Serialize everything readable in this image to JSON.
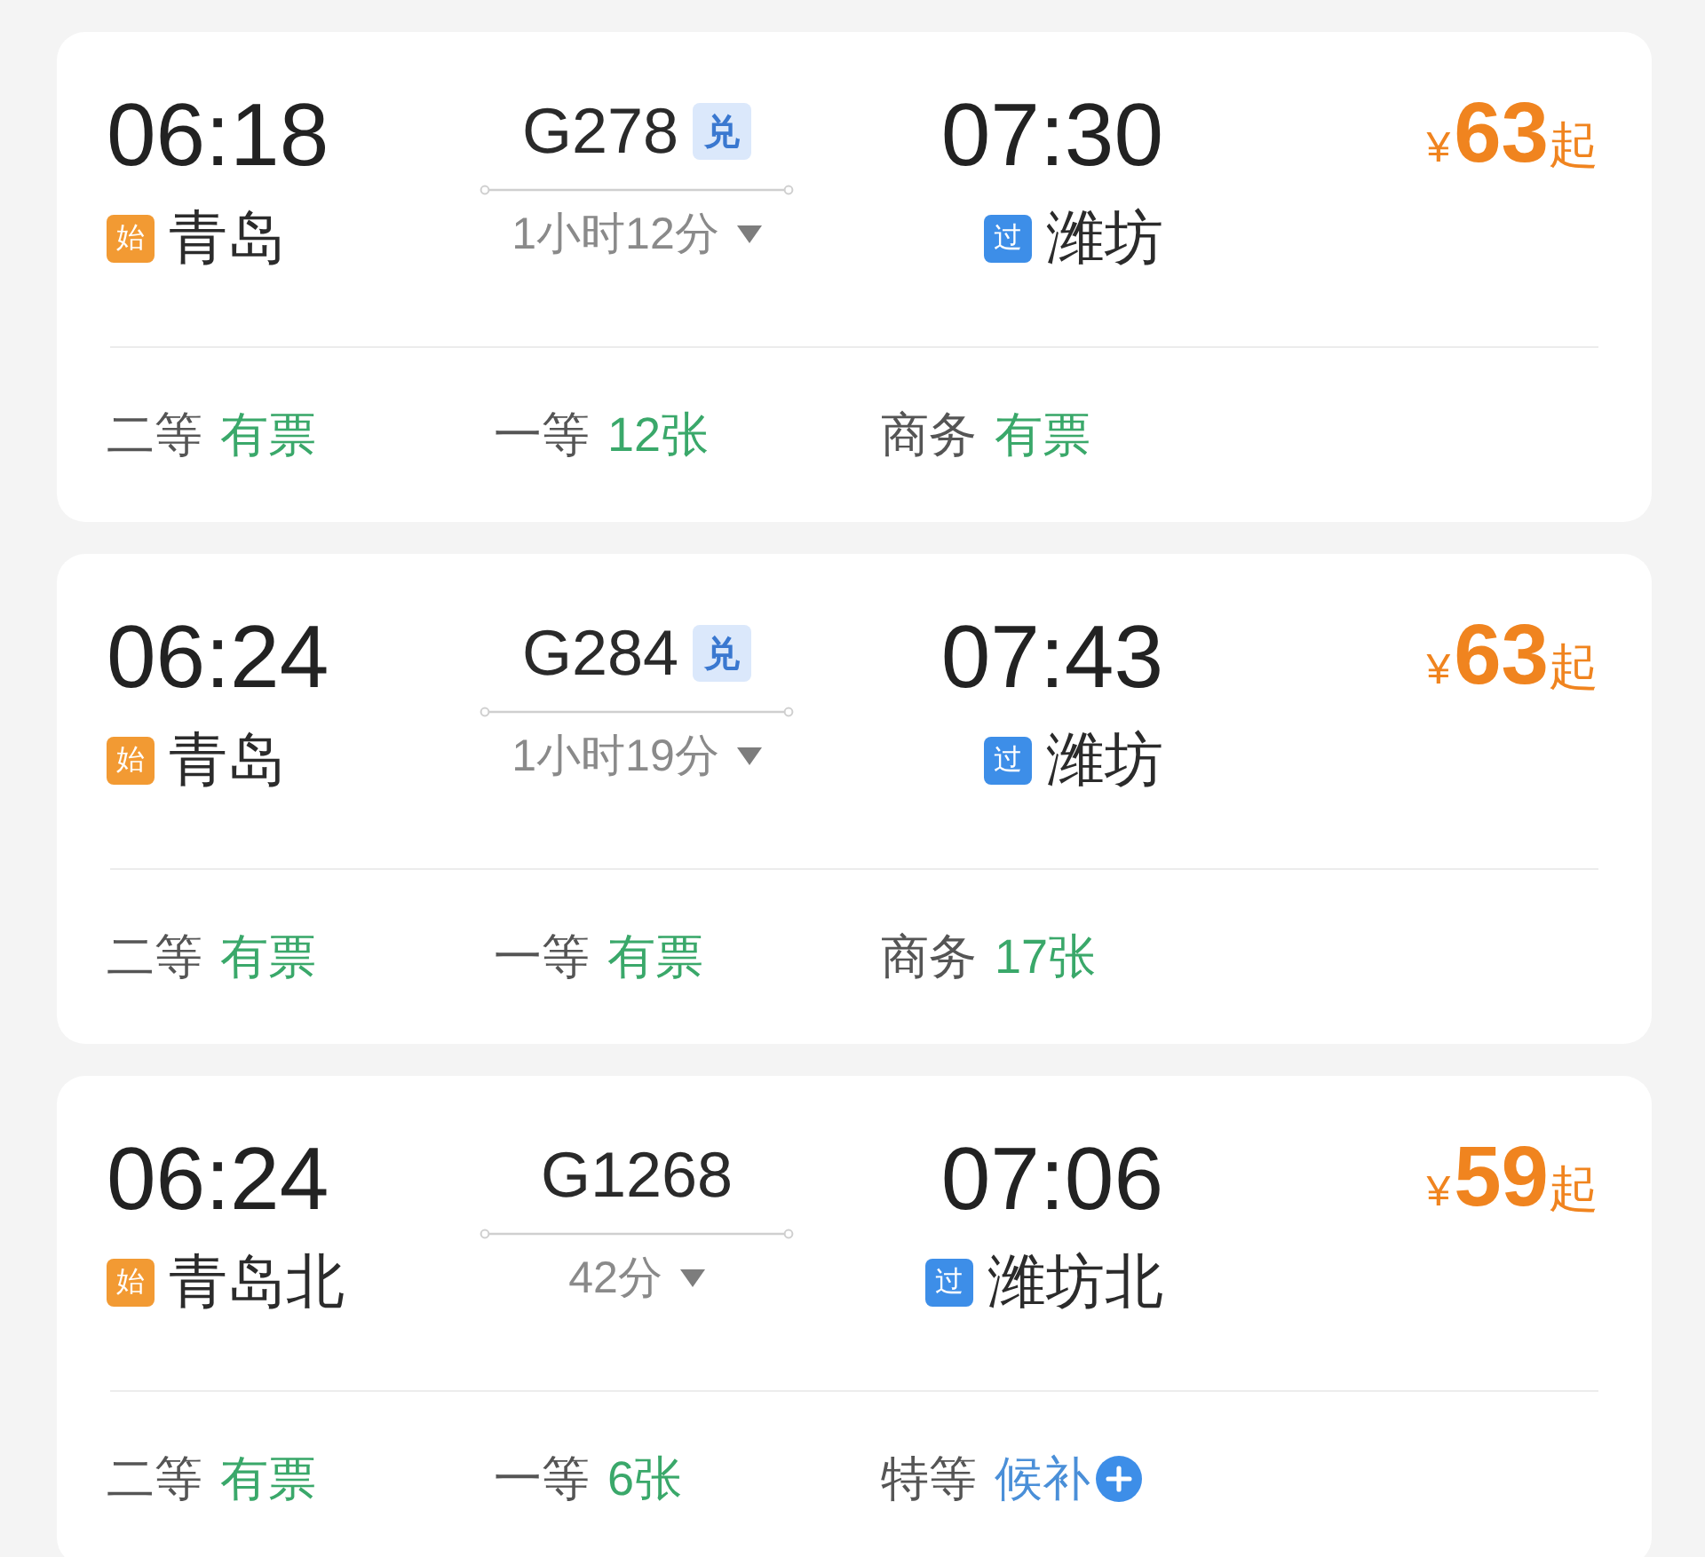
{
  "trains": [
    {
      "departure": {
        "time": "06:18",
        "badge": {
          "text": "始",
          "kind": "origin"
        },
        "station": "青岛"
      },
      "train_number": "G278",
      "tag": "兑",
      "duration": "1小时12分",
      "arrival": {
        "time": "07:30",
        "badge": {
          "text": "过",
          "kind": "passing"
        },
        "station": "潍坊"
      },
      "price": {
        "currency": "¥",
        "amount": "63",
        "suffix": "起"
      },
      "seats": [
        {
          "class": "二等",
          "availability": "有票",
          "kind": "available"
        },
        {
          "class": "一等",
          "availability": "12张",
          "kind": "available"
        },
        {
          "class": "商务",
          "availability": "有票",
          "kind": "available"
        }
      ]
    },
    {
      "departure": {
        "time": "06:24",
        "badge": {
          "text": "始",
          "kind": "origin"
        },
        "station": "青岛"
      },
      "train_number": "G284",
      "tag": "兑",
      "duration": "1小时19分",
      "arrival": {
        "time": "07:43",
        "badge": {
          "text": "过",
          "kind": "passing"
        },
        "station": "潍坊"
      },
      "price": {
        "currency": "¥",
        "amount": "63",
        "suffix": "起"
      },
      "seats": [
        {
          "class": "二等",
          "availability": "有票",
          "kind": "available"
        },
        {
          "class": "一等",
          "availability": "有票",
          "kind": "available"
        },
        {
          "class": "商务",
          "availability": "17张",
          "kind": "available"
        }
      ]
    },
    {
      "departure": {
        "time": "06:24",
        "badge": {
          "text": "始",
          "kind": "origin"
        },
        "station": "青岛北"
      },
      "train_number": "G1268",
      "duration": "42分",
      "arrival": {
        "time": "07:06",
        "badge": {
          "text": "过",
          "kind": "passing"
        },
        "station": "潍坊北"
      },
      "price": {
        "currency": "¥",
        "amount": "59",
        "suffix": "起"
      },
      "seats": [
        {
          "class": "二等",
          "availability": "有票",
          "kind": "available"
        },
        {
          "class": "一等",
          "availability": "6张",
          "kind": "available"
        },
        {
          "class": "特等",
          "availability": "候补",
          "kind": "waitlist"
        }
      ]
    }
  ]
}
